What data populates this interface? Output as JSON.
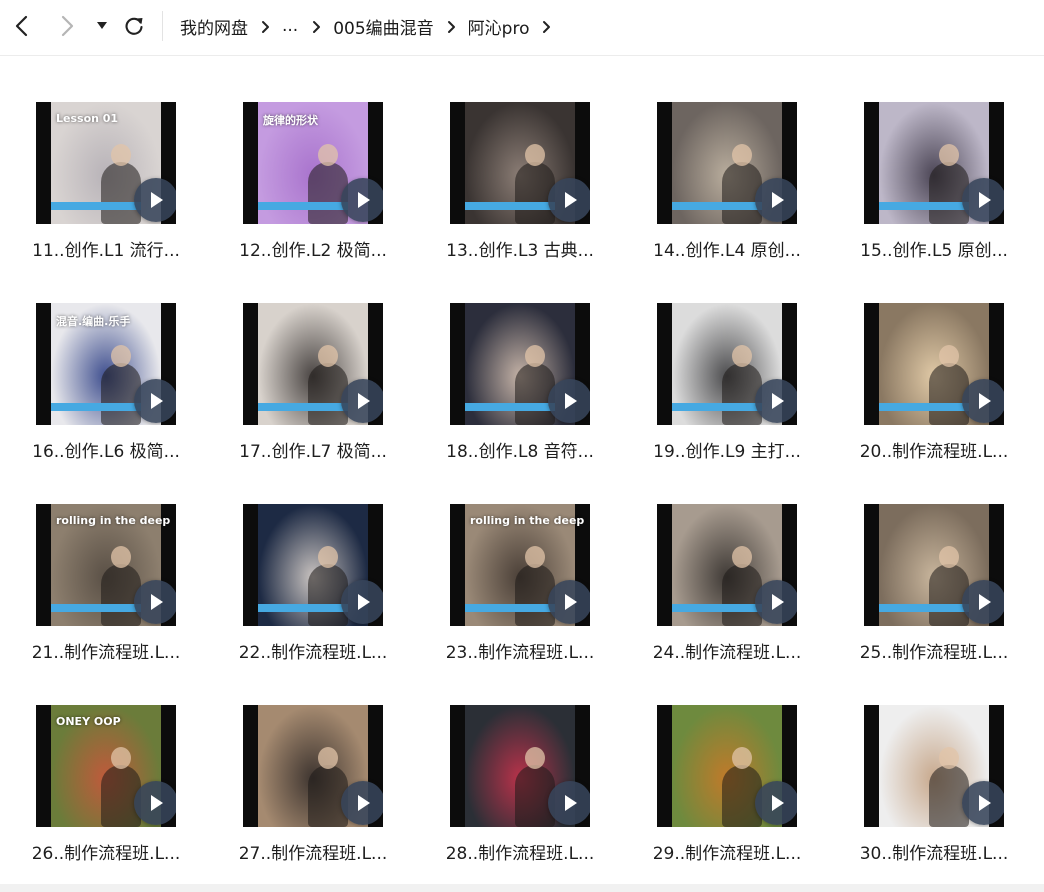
{
  "breadcrumb": {
    "items": [
      "我的网盘",
      "...",
      "005编曲混音",
      "阿沁pro"
    ]
  },
  "files": [
    {
      "name": "11..创作.L1 流行...",
      "overlay": "Lesson 01",
      "bg": "#d9d4d2",
      "bg2": "#b8b3b8"
    },
    {
      "name": "12..创作.L2 极简...",
      "overlay": "旋律的形状",
      "bg": "#c49be0",
      "bg2": "#a974cd"
    },
    {
      "name": "13..创作.L3 古典...",
      "overlay": "",
      "bg": "#3a3432",
      "bg2": "#8b7d75"
    },
    {
      "name": "14..创作.L4 原创...",
      "overlay": "",
      "bg": "#6d6560",
      "bg2": "#b9ad9d"
    },
    {
      "name": "15..创作.L5 原创...",
      "overlay": "",
      "bg": "#bdb7c8",
      "bg2": "#4c4656"
    },
    {
      "name": "16..创作.L6 极简...",
      "overlay": "混音.编曲.乐手",
      "bg": "#e8e8ec",
      "bg2": "#3f4f8f"
    },
    {
      "name": "17..创作.L7 极简...",
      "overlay": "",
      "bg": "#d8d2cc",
      "bg2": "#4a4543"
    },
    {
      "name": "18..创作.L8 音符...",
      "overlay": "",
      "bg": "#2c2e3c",
      "bg2": "#c4b2a6"
    },
    {
      "name": "19..创作.L9 主打...",
      "overlay": "",
      "bg": "#dcdcdc",
      "bg2": "#4d4d4f"
    },
    {
      "name": "20..制作流程班.L...",
      "overlay": "",
      "bg": "#8a7862",
      "bg2": "#e0c9a6"
    },
    {
      "name": "21..制作流程班.L...",
      "overlay": "rolling in the deep",
      "bg": "#8d7f6e",
      "bg2": "#5a5046"
    },
    {
      "name": "22..制作流程班.L...",
      "overlay": "",
      "bg": "#1d2a44",
      "bg2": "#c9c3c0"
    },
    {
      "name": "23..制作流程班.L...",
      "overlay": "rolling in the deep",
      "bg": "#9a8977",
      "bg2": "#4b4038"
    },
    {
      "name": "24..制作流程班.L...",
      "overlay": "",
      "bg": "#a79b8f",
      "bg2": "#3f3a36"
    },
    {
      "name": "25..制作流程班.L...",
      "overlay": "",
      "bg": "#7c6d5d",
      "bg2": "#c8b59c"
    },
    {
      "name": "26..制作流程班.L...",
      "overlay": "ONEY OOP",
      "bg": "#6b7c3a",
      "bg2": "#c05a3b"
    },
    {
      "name": "27..制作流程班.L...",
      "overlay": "",
      "bg": "#a58a70",
      "bg2": "#3e3530"
    },
    {
      "name": "28..制作流程班.L...",
      "overlay": "",
      "bg": "#2b2f36",
      "bg2": "#b8324a"
    },
    {
      "name": "29..制作流程班.L...",
      "overlay": "",
      "bg": "#6e8a3e",
      "bg2": "#c07a2a"
    },
    {
      "name": "30..制作流程班.L...",
      "overlay": "",
      "bg": "#eeeeee",
      "bg2": "#c8a98d"
    }
  ]
}
